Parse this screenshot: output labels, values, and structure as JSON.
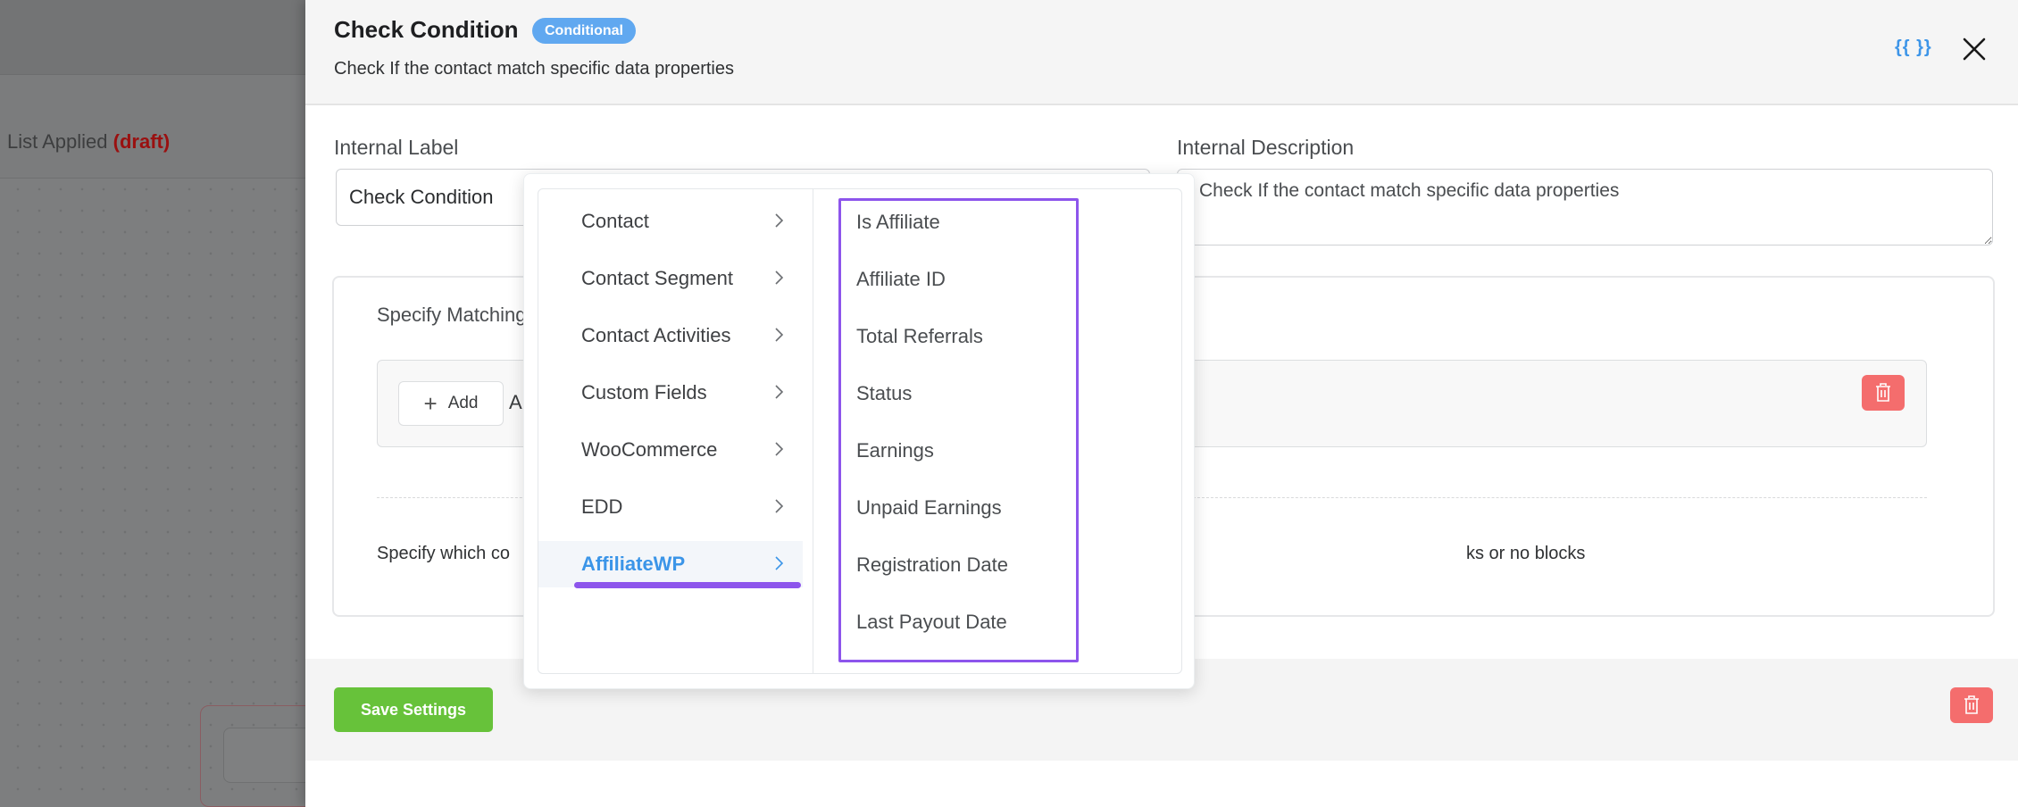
{
  "background": {
    "title": "List Applied",
    "status": "(draft)"
  },
  "drawer": {
    "title": "Check Condition",
    "badge": "Conditional",
    "subtitle": "Check If the contact match specific data properties",
    "smartcode_icon_label": "{{ }}",
    "internal_label": {
      "label": "Internal Label",
      "value": "Check Condition"
    },
    "internal_description": {
      "label": "Internal Description",
      "value": "Check If the contact match specific data properties"
    },
    "matching": {
      "title": "Specify Matching Conditions",
      "add_label": "Add",
      "and_label": "AND",
      "description_start": "Specify which co",
      "description_end": "ks or no blocks"
    },
    "footer": {
      "save_label": "Save Settings"
    }
  },
  "dropdown": {
    "categories": [
      {
        "label": "Contact",
        "active": false
      },
      {
        "label": "Contact Segment",
        "active": false
      },
      {
        "label": "Contact Activities",
        "active": false
      },
      {
        "label": "Custom Fields",
        "active": false
      },
      {
        "label": "WooCommerce",
        "active": false
      },
      {
        "label": "EDD",
        "active": false
      },
      {
        "label": "AffiliateWP",
        "active": true
      }
    ],
    "options": [
      "Is Affiliate",
      "Affiliate ID",
      "Total Referrals",
      "Status",
      "Earnings",
      "Unpaid Earnings",
      "Registration Date",
      "Last Payout Date"
    ]
  },
  "colors": {
    "accent_blue": "#3b95e8",
    "badge_blue": "#60a8f0",
    "highlight_purple": "#8d55ec",
    "save_green": "#67c23a",
    "danger_red": "#f46d6d",
    "draft_red": "#9a1010"
  }
}
